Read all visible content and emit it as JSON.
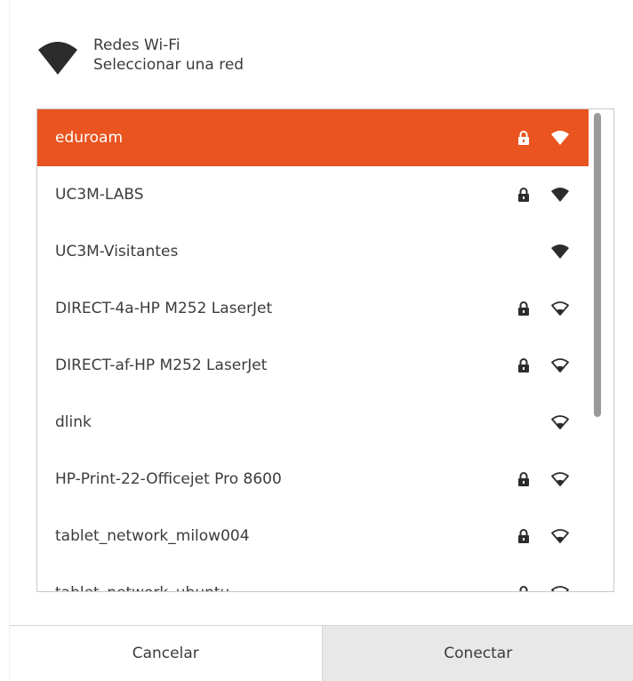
{
  "header": {
    "title": "Redes Wi-Fi",
    "subtitle": "Seleccionar una red"
  },
  "networks": [
    {
      "name": "eduroam",
      "locked": true,
      "signal": "full",
      "selected": true
    },
    {
      "name": "UC3M-LABS",
      "locked": true,
      "signal": "full",
      "selected": false
    },
    {
      "name": "UC3M-Visitantes",
      "locked": false,
      "signal": "full",
      "selected": false
    },
    {
      "name": "DIRECT-4a-HP M252 LaserJet",
      "locked": true,
      "signal": "outline",
      "selected": false
    },
    {
      "name": "DIRECT-af-HP M252 LaserJet",
      "locked": true,
      "signal": "outline",
      "selected": false
    },
    {
      "name": "dlink",
      "locked": false,
      "signal": "outline",
      "selected": false
    },
    {
      "name": "HP-Print-22-Officejet Pro 8600",
      "locked": true,
      "signal": "outline",
      "selected": false
    },
    {
      "name": "tablet_network_milow004",
      "locked": true,
      "signal": "outline",
      "selected": false
    },
    {
      "name": "tablet_network_ubuntu",
      "locked": true,
      "signal": "outline",
      "selected": false
    }
  ],
  "buttons": {
    "cancel": "Cancelar",
    "connect": "Conectar"
  },
  "colors": {
    "accent": "#e95420",
    "text": "#3c3c3c",
    "icon": "#2c2c2c"
  },
  "icons": {
    "header": "wifi-icon",
    "lock": "lock-icon",
    "signal": "wifi-signal-icon"
  }
}
